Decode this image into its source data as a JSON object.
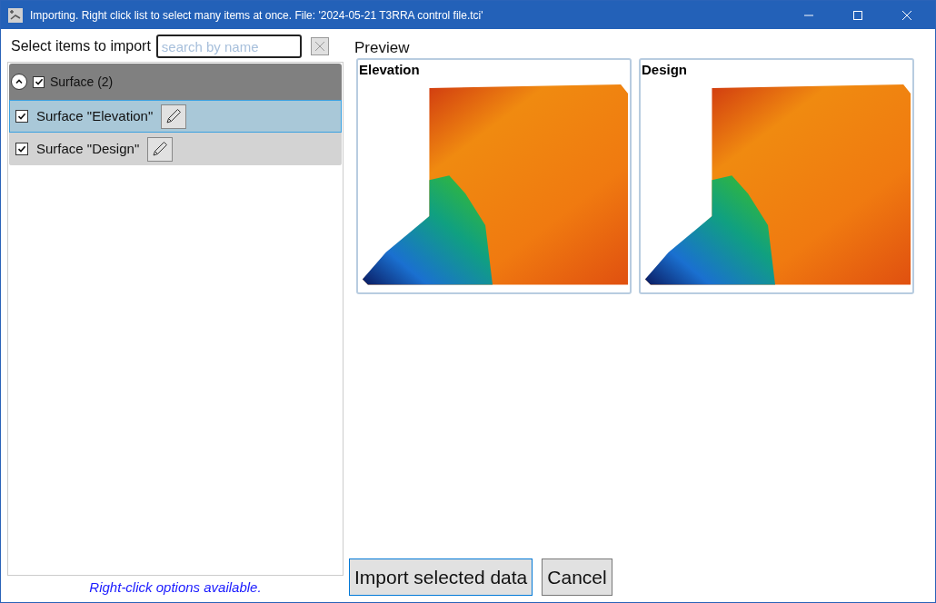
{
  "window": {
    "title": "Importing. Right click list to select many items at once. File: '2024-05-21 T3RRA control file.tci'"
  },
  "select_panel": {
    "title": "Select items to import",
    "search": {
      "placeholder": "search by name"
    },
    "groups": [
      {
        "label": "Surface (2)",
        "expanded": true,
        "checked": true,
        "children": [
          {
            "label": "Surface \"Elevation\"",
            "checked": true,
            "selected": true
          },
          {
            "label": "Surface \"Design\"",
            "checked": true,
            "selected": false
          }
        ]
      }
    ],
    "hint": "Right-click options available."
  },
  "preview": {
    "title": "Preview",
    "cards": [
      {
        "title": "Elevation"
      },
      {
        "title": "Design"
      }
    ]
  },
  "buttons": [
    {
      "label": "Import selected data",
      "default": true
    },
    {
      "label": "Cancel",
      "default": false
    }
  ]
}
